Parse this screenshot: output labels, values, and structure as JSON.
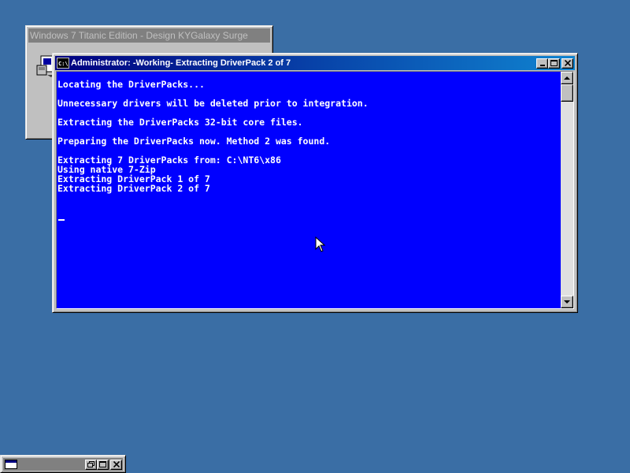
{
  "background_window": {
    "title": "Windows 7 Titanic Edition - Design KYGalaxy Surge"
  },
  "console": {
    "title": "Administrator:  -Working- Extracting DriverPack 2 of 7",
    "lines": [
      "Locating the DriverPacks...",
      "",
      "Unnecessary drivers will be deleted prior to integration.",
      "",
      "Extracting the DriverPacks 32-bit core files.",
      "",
      "Preparing the DriverPacks now. Method 2 was found.",
      "",
      "Extracting 7 DriverPacks from: C:\\NT6\\x86",
      "Using native 7-Zip",
      "Extracting DriverPack 1 of 7",
      "Extracting DriverPack 2 of 7"
    ],
    "text": "Locating the DriverPacks...\n\nUnnecessary drivers will be deleted prior to integration.\n\nExtracting the DriverPacks 32-bit core files.\n\nPreparing the DriverPacks now. Method 2 was found.\n\nExtracting 7 DriverPacks from: C:\\NT6\\x86\nUsing native 7-Zip\nExtracting DriverPack 1 of 7\nExtracting DriverPack 2 of 7"
  },
  "icons": {
    "console_app": "console-app-icon",
    "minimize": "minimize-icon",
    "maximize": "maximize-icon",
    "restore": "restore-icon",
    "close": "close-icon",
    "scroll_up": "arrow-up-icon",
    "scroll_down": "arrow-down-icon",
    "pointer": "mouse-pointer-icon"
  },
  "colors": {
    "desktop": "#3a6ea5",
    "console_background": "#0000ff",
    "console_text": "#ffffff",
    "active_title": "#000080",
    "inactive_title": "#808080"
  }
}
